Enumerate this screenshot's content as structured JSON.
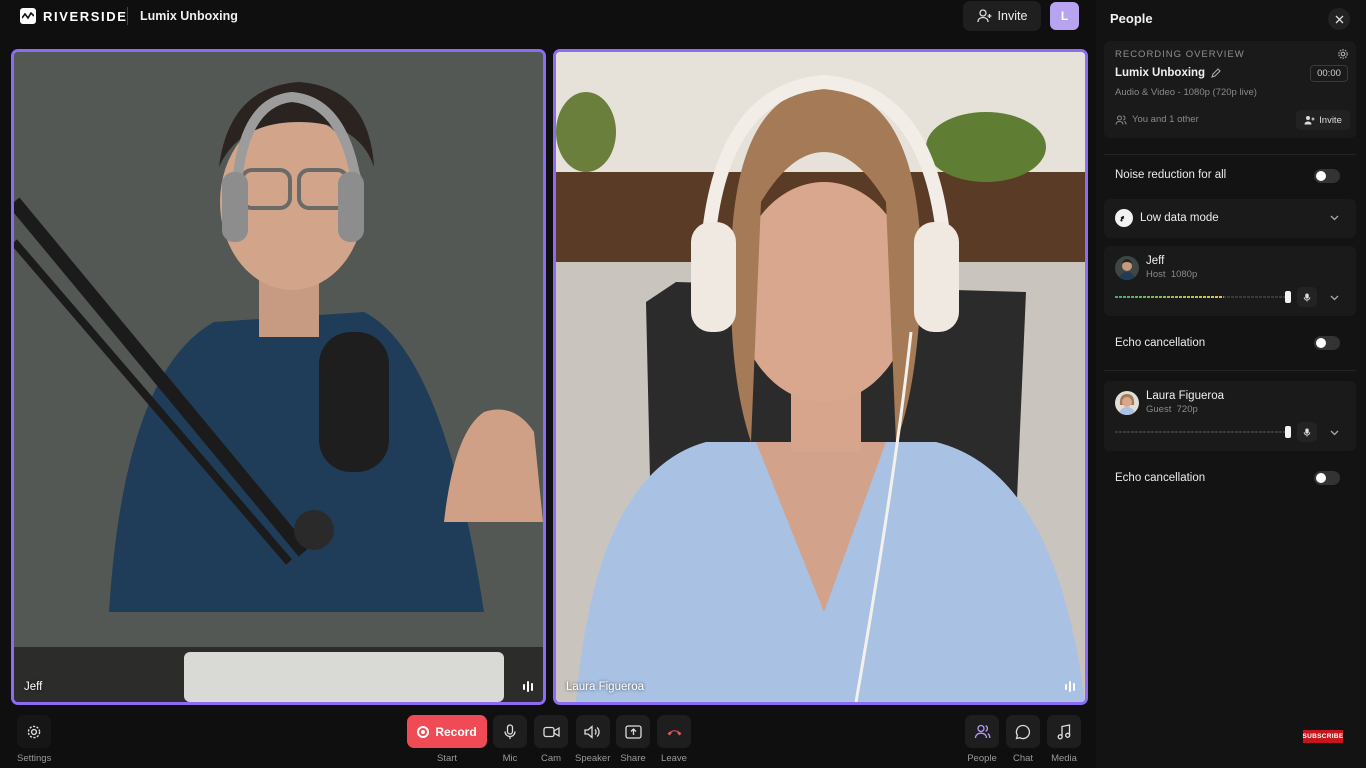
{
  "app": {
    "brand": "RIVERSIDE",
    "project_title": "Lumix Unboxing",
    "invite_label": "Invite",
    "avatar_initial": "L"
  },
  "tiles": [
    {
      "name": "Jeff"
    },
    {
      "name": "Laura Figueroa"
    }
  ],
  "controls": {
    "settings": "Settings",
    "record": "Record",
    "start": "Start",
    "mic": "Mic",
    "cam": "Cam",
    "speaker": "Speaker",
    "share": "Share",
    "leave": "Leave",
    "people": "People",
    "chat": "Chat",
    "media": "Media"
  },
  "panel": {
    "title": "People",
    "overview_label": "RECORDING OVERVIEW",
    "recording_name": "Lumix Unboxing",
    "timer": "00:00",
    "recording_sub": "Audio & Video - 1080p (720p live)",
    "participants_summary": "You and 1 other",
    "invite_label": "Invite",
    "noise_reduction": {
      "label": "Noise reduction for all",
      "enabled": false
    },
    "low_data_mode": {
      "label": "Low data mode"
    },
    "participants": [
      {
        "name": "Jeff",
        "role": "Host",
        "quality": "1080p",
        "echo_label": "Echo cancellation",
        "echo_enabled": false,
        "level": 0.62
      },
      {
        "name": "Laura Figueroa",
        "role": "Guest",
        "quality": "720p",
        "echo_label": "Echo cancellation",
        "echo_enabled": false,
        "level": 0.0
      }
    ]
  },
  "subscribe_badge": "SUBSCRIBE",
  "colors": {
    "tile_border": "#8b6cf2",
    "record": "#f04a55",
    "avatar": "#b8a3f0",
    "leave_icon": "#f0525c"
  }
}
